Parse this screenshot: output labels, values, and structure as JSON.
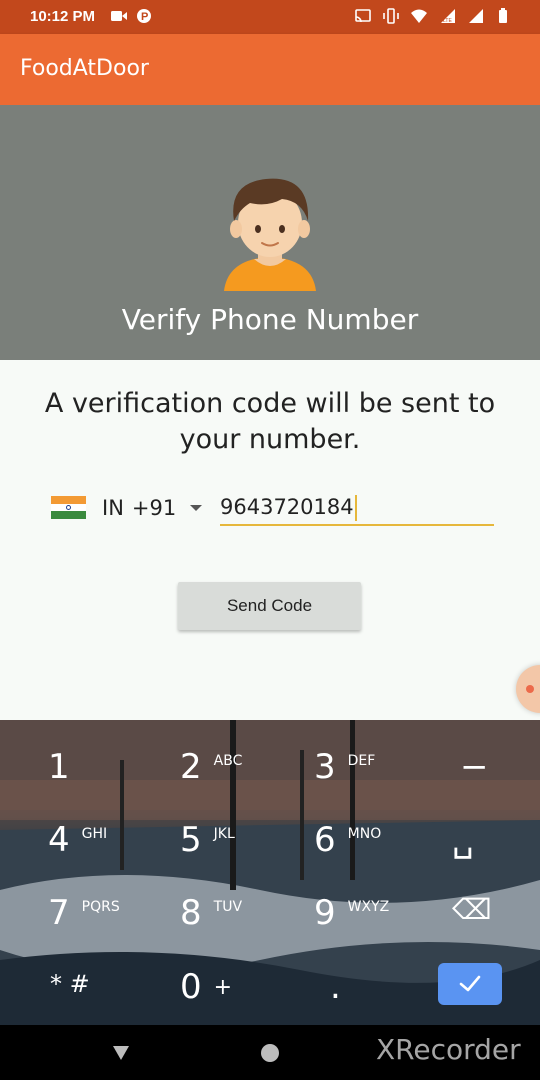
{
  "status_bar": {
    "time": "10:12 PM",
    "icons_left": [
      "video-recording-icon",
      "parking-app-icon"
    ],
    "icons_right": [
      "cast-icon",
      "vibrate-icon",
      "wifi-icon",
      "lte-signal-icon",
      "signal-icon",
      "battery-icon"
    ]
  },
  "app_bar": {
    "title": "FoodAtDoor",
    "color": "#ec6a32"
  },
  "header": {
    "title": "Verify Phone Number",
    "avatar_icon": "user-avatar-icon"
  },
  "form": {
    "info_text": "A verification code will be sent to your number.",
    "country_code": "IN",
    "dial_code": "+91",
    "phone_value": "9643720184",
    "send_button_label": "Send Code"
  },
  "keyboard": {
    "keys": [
      {
        "num": "1",
        "letters": ""
      },
      {
        "num": "2",
        "letters": "ABC"
      },
      {
        "num": "3",
        "letters": "DEF"
      },
      {
        "num": "−",
        "letters": ""
      },
      {
        "num": "4",
        "letters": "GHI"
      },
      {
        "num": "5",
        "letters": "JKL"
      },
      {
        "num": "6",
        "letters": "MNO"
      },
      {
        "num": "␣",
        "letters": ""
      },
      {
        "num": "7",
        "letters": "PQRS"
      },
      {
        "num": "8",
        "letters": "TUV"
      },
      {
        "num": "9",
        "letters": "WXYZ"
      },
      {
        "num": "⌫",
        "letters": ""
      },
      {
        "num": "* #",
        "letters": ""
      },
      {
        "num": "0",
        "letters": "+"
      },
      {
        "num": ".",
        "letters": ""
      }
    ],
    "done_icon": "check-icon"
  },
  "nav_bar": {
    "watermark": "XRecorder"
  }
}
